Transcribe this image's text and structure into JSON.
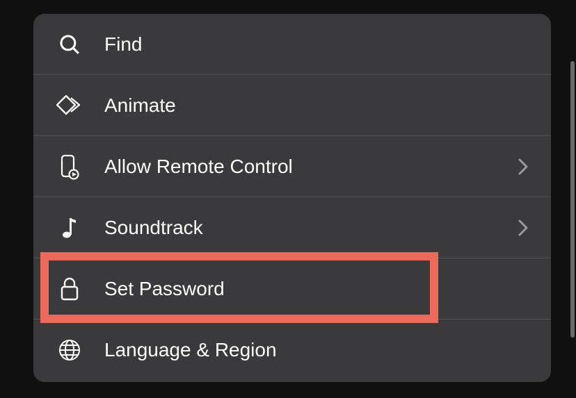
{
  "menu": {
    "items": [
      {
        "icon": "search-icon",
        "label": "Find",
        "disclosure": false
      },
      {
        "icon": "animate-icon",
        "label": "Animate",
        "disclosure": false
      },
      {
        "icon": "remote-icon",
        "label": "Allow Remote Control",
        "disclosure": true
      },
      {
        "icon": "music-icon",
        "label": "Soundtrack",
        "disclosure": true
      },
      {
        "icon": "lock-icon",
        "label": "Set Password",
        "disclosure": false
      },
      {
        "icon": "globe-icon",
        "label": "Language & Region",
        "disclosure": false
      }
    ]
  },
  "highlight_color": "#ec6a59"
}
